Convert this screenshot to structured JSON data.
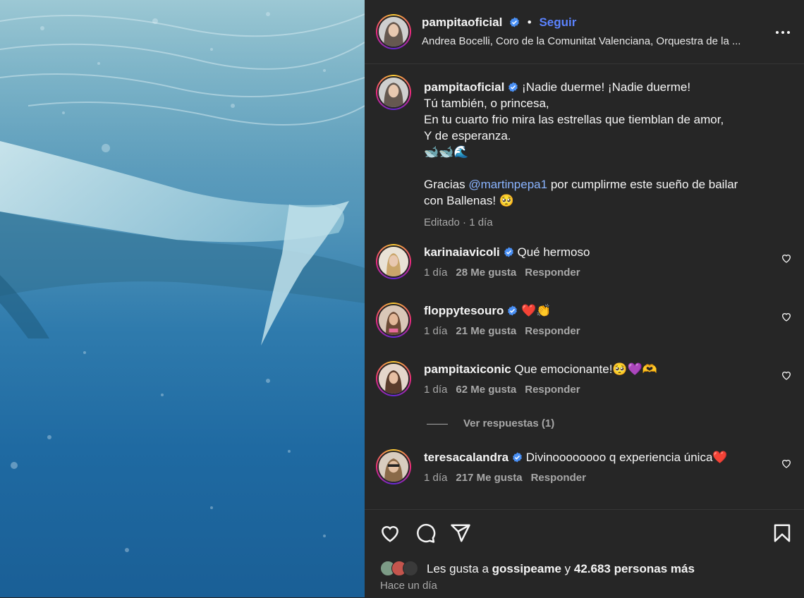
{
  "header": {
    "username": "pampitaoficial",
    "separator": "•",
    "follow_label": "Seguir",
    "audio": "Andrea Bocelli, Coro de la Comunitat Valenciana, Orquestra de la ..."
  },
  "caption": {
    "username": "pampitaoficial",
    "line1": "¡Nadie duerme! ¡Nadie duerme!",
    "line2": "Tú también, o princesa,",
    "line3": "En tu cuarto frio mira las estrellas que tiemblan de amor,",
    "line4": "Y de esperanza.",
    "line5": "🐋🐋🌊",
    "thanks_pre": "Gracias",
    "mention": "@martinpepa1",
    "thanks_post": "por cumplirme este sueño de bailar",
    "line7": "con Ballenas! 🥺",
    "meta": "Editado · 1 día"
  },
  "comments": [
    {
      "user": "karinaiavicoli",
      "text": "Qué hermoso",
      "time": "1 día",
      "likes": "28 Me gusta",
      "reply": "Responder"
    },
    {
      "user": "floppytesouro",
      "text": "❤️👏",
      "time": "1 día",
      "likes": "21 Me gusta",
      "reply": "Responder"
    },
    {
      "user": "pampitaxiconic",
      "text": "Que emocionante!🥺💜🫶",
      "time": "1 día",
      "likes": "62 Me gusta",
      "reply": "Responder"
    },
    {
      "user": "teresacalandra",
      "text": "Divinoooooooo q experiencia única❤️",
      "time": "1 día",
      "likes": "217 Me gusta",
      "reply": "Responder"
    }
  ],
  "view_replies": "Ver respuestas (1)",
  "likes": {
    "prefix": "Les gusta a",
    "user": "gossipeame",
    "mid": "y",
    "count": "42.683 personas más"
  },
  "posted": "Hace un día",
  "colors": {
    "accent": "#5b83ff",
    "mention": "#8ab4ff",
    "verified": "#4a90f5",
    "background": "#262626"
  },
  "icons": [
    "verified-badge-icon",
    "more-options-icon",
    "heart-icon",
    "comment-icon",
    "share-icon",
    "bookmark-icon"
  ]
}
